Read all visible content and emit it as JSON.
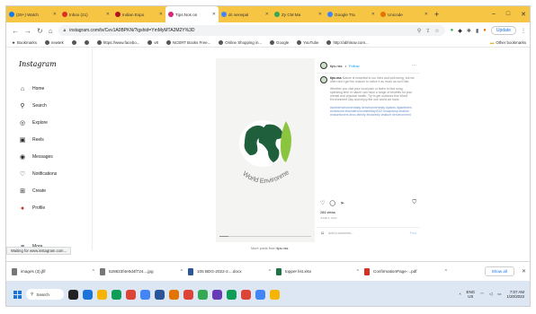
{
  "browser": {
    "tabs": [
      {
        "label": "(29+) Watch",
        "color": "#1877f2",
        "active": false
      },
      {
        "label": "Inbox (21)",
        "color": "#d93025",
        "active": false
      },
      {
        "label": "Indian Expo",
        "color": "#b1121f",
        "active": false
      },
      {
        "label": "Tips.Nos on",
        "color": "#d62976",
        "active": true
      },
      {
        "label": "dc senepal",
        "color": "#4285f4",
        "active": false
      },
      {
        "label": "Zy CM Ma",
        "color": "#34a853",
        "active": false
      },
      {
        "label": "Google Tra",
        "color": "#4285f4",
        "active": false
      },
      {
        "label": "Unicode",
        "color": "#e37400",
        "active": false
      }
    ],
    "new_tab": "+",
    "window_controls": {
      "minimize": "–",
      "maximize": "□",
      "close": "✕"
    },
    "url": "instagram.com/tv/Cev1A0BPKN/?igshid=YmMyMTA2M2Y%3D",
    "update_label": "Update",
    "bookmarks": [
      "Bookmarks",
      "newtek",
      "",
      "",
      "https://www.facebo...",
      "v8",
      "NCERT Books Free...",
      "Online Shopping in...",
      "Google",
      "YouTube",
      "http://abhinav.com..."
    ],
    "other_bookmarks": "Other bookmarks",
    "status_text": "Waiting for www.instagram.com..."
  },
  "instagram": {
    "brand": "Instagram",
    "nav": [
      {
        "label": "Home",
        "icon": "home-icon",
        "glyph": "⌂"
      },
      {
        "label": "Search",
        "icon": "search-icon",
        "glyph": "⚲"
      },
      {
        "label": "Explore",
        "icon": "compass-icon",
        "glyph": "◎"
      },
      {
        "label": "Reels",
        "icon": "reels-icon",
        "glyph": "▣"
      },
      {
        "label": "Messages",
        "icon": "messenger-icon",
        "glyph": "◉"
      },
      {
        "label": "Notifications",
        "icon": "heart-icon",
        "glyph": "♡"
      },
      {
        "label": "Create",
        "icon": "plus-square-icon",
        "glyph": "⊞"
      },
      {
        "label": "Profile",
        "icon": "avatar-icon",
        "glyph": "●"
      }
    ],
    "more_label": "More",
    "post": {
      "username": "tips.nss",
      "follow_label": "Follow",
      "media_text": "World Environment Day",
      "caption_user": "tips.nss",
      "caption_paragraphs": [
        "Nature is essential to our lives and well-being, but we often don't get the chance to notice it as much as we'd like.",
        "Whether you visit your local park or listen to bird song, spending time in nature can have a range of benefits for your mental and physical health. Try to get outdoors this World Environment Day and enjoy the one world we have."
      ],
      "hashtags": "#worldenvironmentday #environmentday #plants #planttrees #oneworld #worldenvironmentday2022 #nssplamp #nature #naturelovers #nss #trinity #nsstrinity #nature #environment",
      "views": "284 views",
      "date": "JUNE 5, 2022",
      "comment_placeholder": "Add a comment...",
      "post_label": "Post"
    },
    "more_posts_prefix": "More posts from",
    "more_posts_user": "tips.nss"
  },
  "downloads": [
    {
      "name": "images (3).jfif",
      "color": "#777777"
    },
    {
      "name": "528823f4e0d4f724....jpg",
      "color": "#777777"
    },
    {
      "name": "105 BDG-2022-2....docx",
      "color": "#2b579a"
    },
    {
      "name": "topper list.xlsx",
      "color": "#217346"
    },
    {
      "name": "ConfirmationPage-...pdf",
      "color": "#d93025"
    }
  ],
  "show_all": "Show all",
  "taskbar": {
    "search_label": "Search",
    "apps": [
      "#222222",
      "#1a73d9",
      "#f4b400",
      "#0f9d58",
      "#db4437",
      "#4285f4",
      "#2b579a",
      "#e37400",
      "#db4437",
      "#34a853",
      "#673ab7",
      "#0f9d58",
      "#db4437",
      "#4285f4",
      "#f4b400"
    ],
    "lang_top": "ENG",
    "lang_bottom": "US",
    "time": "7:07 AM",
    "date": "1/20/2023"
  },
  "accent": "#0095f6"
}
